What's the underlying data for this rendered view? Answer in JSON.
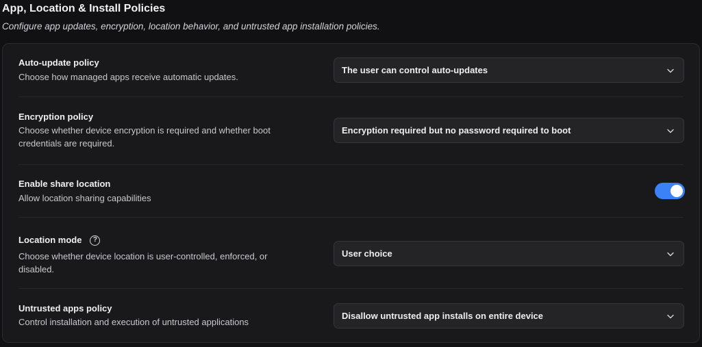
{
  "page": {
    "title": "App, Location & Install Policies",
    "subtitle": "Configure app updates, encryption, location behavior, and untrusted app installation policies."
  },
  "settings": [
    {
      "title": "Auto-update policy",
      "description": "Choose how managed apps receive automatic updates.",
      "control": "select",
      "value": "The user can control auto-updates"
    },
    {
      "title": "Encryption policy",
      "description": "Choose whether device encryption is required and whether boot credentials are required.",
      "control": "select",
      "value": "Encryption required but no password required to boot"
    },
    {
      "title": "Enable share location",
      "description": "Allow location sharing capabilities",
      "control": "toggle",
      "checked": true
    },
    {
      "title": "Location mode",
      "description": "Choose whether device location is user-controlled, enforced, or disabled.",
      "control": "select",
      "value": "User choice",
      "help_icon": "question-circle-icon"
    },
    {
      "title": "Untrusted apps policy",
      "description": "Control installation and execution of untrusted applications",
      "control": "select",
      "value": "Disallow untrusted app installs on entire device"
    }
  ],
  "colors": {
    "background": "#111113",
    "card": "#19191b",
    "toggle_on": "#3b82f6"
  }
}
